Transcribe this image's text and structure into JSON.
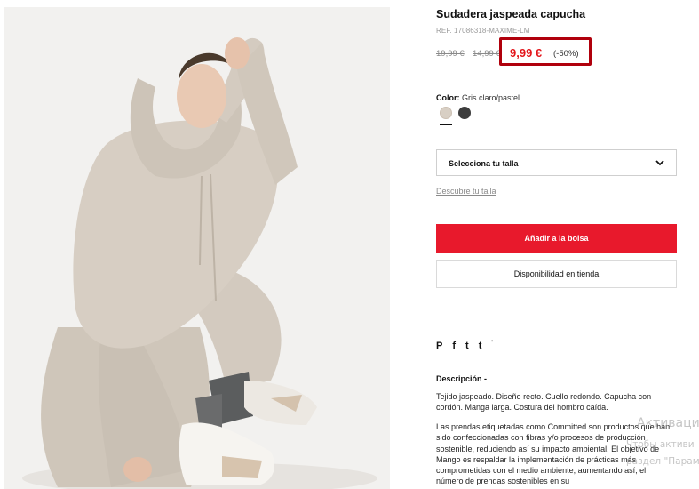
{
  "product": {
    "title": "Sudadera jaspeada capucha",
    "ref": "REF. 17086318-MAXIME-LM",
    "old_price_1": "19,99 €",
    "old_price_2": "14,99 €",
    "price": "9,99 €",
    "discount": "(-50%)",
    "image_alt": "Sudadera jaspeada capucha"
  },
  "color": {
    "label": "Color:",
    "value": "Gris claro/pastel",
    "swatches": [
      {
        "name": "Gris claro/pastel",
        "hex": "#d8cfc4",
        "selected": true
      },
      {
        "name": "dark-grey",
        "hex": "#3d3d3d",
        "selected": false
      }
    ]
  },
  "size": {
    "select_label": "Selecciona tu talla",
    "guide_link": "Descubre tu talla"
  },
  "actions": {
    "add_to_bag": "Añadir a la bolsa",
    "store_availability": "Disponibilidad en tienda"
  },
  "social": {
    "pinterest": "P",
    "facebook": "f",
    "twitter": "t",
    "tumblr": "t",
    "more": "'"
  },
  "description": {
    "title": "Descripción",
    "toggle": "-",
    "paragraph_1": "Tejido jaspeado. Diseño recto. Cuello redondo. Capucha con cordón. Manga larga. Costura del hombro caída.",
    "paragraph_2": "Las prendas etiquetadas como Committed son productos que han sido confeccionadas con fibras y/o procesos de producción sostenible, reduciendo así su impacto ambiental. El objetivo de Mango es respaldar la implementación de prácticas más comprometidas con el medio ambiente, aumentando así, el número de prendas sostenibles en su"
  },
  "watermark": {
    "line1": "Активация",
    "line2": "Чтобы активи",
    "line3": "раздел \"Парам"
  },
  "colors": {
    "brand_red": "#e8192c",
    "price_red": "#e3161b",
    "highlight_border": "#b0000c"
  }
}
